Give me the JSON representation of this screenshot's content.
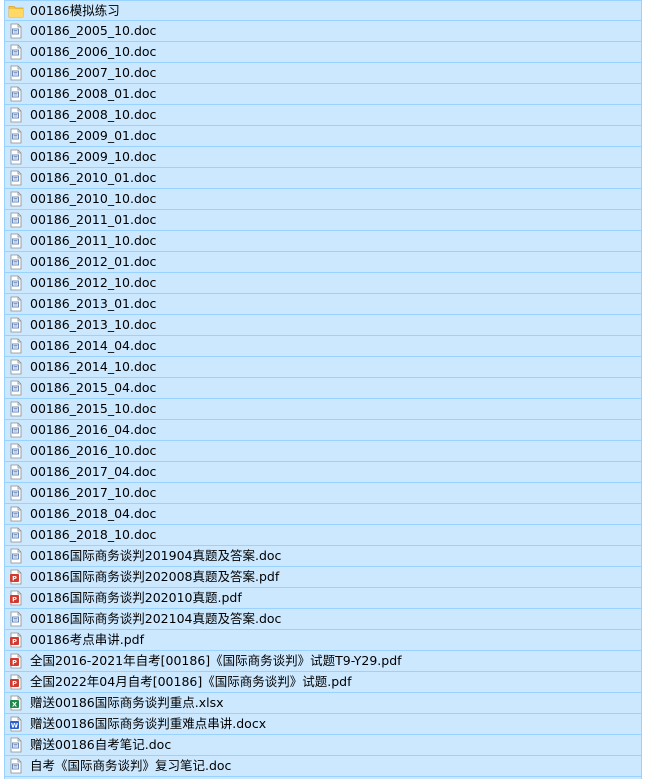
{
  "colors": {
    "selection_background": "#cce8ff",
    "selection_border": "#99d1ff",
    "folder": "#f5c440",
    "doc_accent": "#5b7fb8",
    "pdf_accent": "#d23a2f",
    "xlsx_accent": "#1e8a4a",
    "docx_accent": "#2b62c9"
  },
  "files": [
    {
      "name": "00186模拟练习",
      "icon": "folder-icon"
    },
    {
      "name": "00186_2005_10.doc",
      "icon": "doc-icon"
    },
    {
      "name": "00186_2006_10.doc",
      "icon": "doc-icon"
    },
    {
      "name": "00186_2007_10.doc",
      "icon": "doc-icon"
    },
    {
      "name": "00186_2008_01.doc",
      "icon": "doc-icon"
    },
    {
      "name": "00186_2008_10.doc",
      "icon": "doc-icon"
    },
    {
      "name": "00186_2009_01.doc",
      "icon": "doc-icon"
    },
    {
      "name": "00186_2009_10.doc",
      "icon": "doc-icon"
    },
    {
      "name": "00186_2010_01.doc",
      "icon": "doc-icon"
    },
    {
      "name": "00186_2010_10.doc",
      "icon": "doc-icon"
    },
    {
      "name": "00186_2011_01.doc",
      "icon": "doc-icon"
    },
    {
      "name": "00186_2011_10.doc",
      "icon": "doc-icon"
    },
    {
      "name": "00186_2012_01.doc",
      "icon": "doc-icon"
    },
    {
      "name": "00186_2012_10.doc",
      "icon": "doc-icon"
    },
    {
      "name": "00186_2013_01.doc",
      "icon": "doc-icon"
    },
    {
      "name": "00186_2013_10.doc",
      "icon": "doc-icon"
    },
    {
      "name": "00186_2014_04.doc",
      "icon": "doc-icon"
    },
    {
      "name": "00186_2014_10.doc",
      "icon": "doc-icon"
    },
    {
      "name": "00186_2015_04.doc",
      "icon": "doc-icon"
    },
    {
      "name": "00186_2015_10.doc",
      "icon": "doc-icon"
    },
    {
      "name": "00186_2016_04.doc",
      "icon": "doc-icon"
    },
    {
      "name": "00186_2016_10.doc",
      "icon": "doc-icon"
    },
    {
      "name": "00186_2017_04.doc",
      "icon": "doc-icon"
    },
    {
      "name": "00186_2017_10.doc",
      "icon": "doc-icon"
    },
    {
      "name": "00186_2018_04.doc",
      "icon": "doc-icon"
    },
    {
      "name": "00186_2018_10.doc",
      "icon": "doc-icon"
    },
    {
      "name": "00186国际商务谈判201904真题及答案.doc",
      "icon": "doc-icon"
    },
    {
      "name": "00186国际商务谈判202008真题及答案.pdf",
      "icon": "pdf-icon"
    },
    {
      "name": "00186国际商务谈判202010真题.pdf",
      "icon": "pdf-icon"
    },
    {
      "name": "00186国际商务谈判202104真题及答案.doc",
      "icon": "doc-icon"
    },
    {
      "name": "00186考点串讲.pdf",
      "icon": "pdf-icon"
    },
    {
      "name": "全国2016-2021年自考[00186]《国际商务谈判》试题T9-Y29.pdf",
      "icon": "pdf-icon"
    },
    {
      "name": "全国2022年04月自考[00186]《国际商务谈判》试题.pdf",
      "icon": "pdf-icon"
    },
    {
      "name": "赠送00186国际商务谈判重点.xlsx",
      "icon": "xlsx-icon"
    },
    {
      "name": "赠送00186国际商务谈判重难点串讲.docx",
      "icon": "docx-icon"
    },
    {
      "name": "赠送00186自考笔记.doc",
      "icon": "doc-icon"
    },
    {
      "name": "自考《国际商务谈判》复习笔记.doc",
      "icon": "doc-icon"
    }
  ]
}
